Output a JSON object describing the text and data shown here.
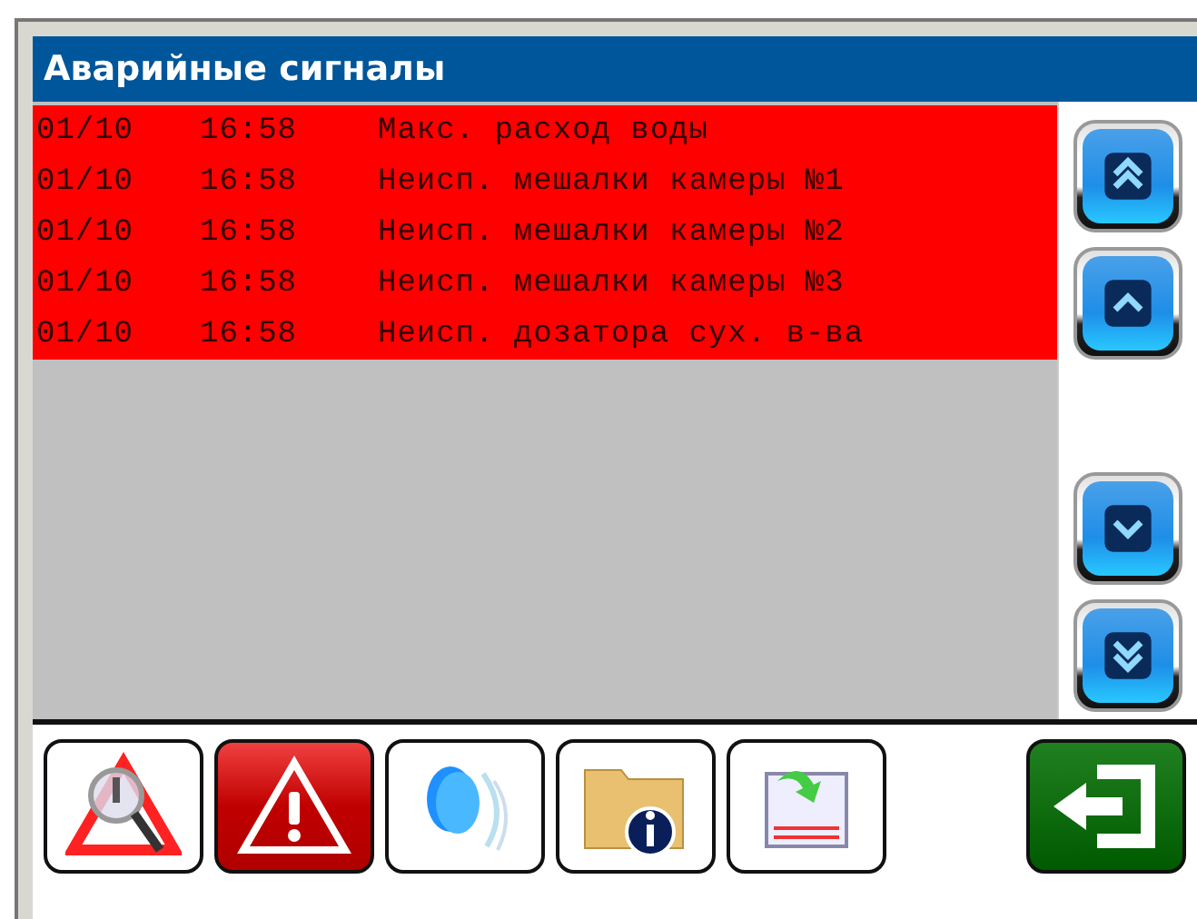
{
  "window": {
    "title": "Аварийные сигналы"
  },
  "alarms": [
    {
      "date": "01/10",
      "time": "16:58",
      "message": "Макс. расход воды"
    },
    {
      "date": "01/10",
      "time": "16:58",
      "message": "Неисп. мешалки камеры №1"
    },
    {
      "date": "01/10",
      "time": "16:58",
      "message": "Неисп. мешалки камеры №2"
    },
    {
      "date": "01/10",
      "time": "16:58",
      "message": "Неисп. мешалки камеры №3"
    },
    {
      "date": "01/10",
      "time": "16:58",
      "message": "Неисп. дозатора сух. в-ва"
    }
  ],
  "scroll_buttons": [
    {
      "kind": "first"
    },
    {
      "kind": "up"
    },
    {
      "kind": "down"
    },
    {
      "kind": "last"
    }
  ],
  "toolbar": [
    {
      "kind": "search",
      "selected": false
    },
    {
      "kind": "alarm",
      "selected": true
    },
    {
      "kind": "sound",
      "selected": false
    },
    {
      "kind": "info",
      "selected": false
    },
    {
      "kind": "export",
      "selected": false
    },
    {
      "kind": "exit",
      "selected": false
    }
  ]
}
